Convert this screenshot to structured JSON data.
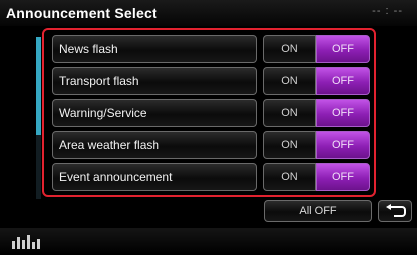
{
  "header": {
    "title": "Announcement Select",
    "clock": "-- : --"
  },
  "rows": [
    {
      "label": "News flash",
      "on": "ON",
      "off": "OFF",
      "selected": "OFF"
    },
    {
      "label": "Transport flash",
      "on": "ON",
      "off": "OFF",
      "selected": "OFF"
    },
    {
      "label": "Warning/Service",
      "on": "ON",
      "off": "OFF",
      "selected": "OFF"
    },
    {
      "label": "Area weather flash",
      "on": "ON",
      "off": "OFF",
      "selected": "OFF"
    },
    {
      "label": "Event announcement",
      "on": "ON",
      "off": "OFF",
      "selected": "OFF"
    }
  ],
  "buttons": {
    "all_off": "All OFF",
    "back_icon": "return-arrow-icon"
  },
  "footer": {
    "icon": "equalizer-bars-icon"
  },
  "colors": {
    "selected": "#9b2ccc",
    "highlight_border": "#e2222f",
    "scrollbar": "#35a7c2"
  }
}
